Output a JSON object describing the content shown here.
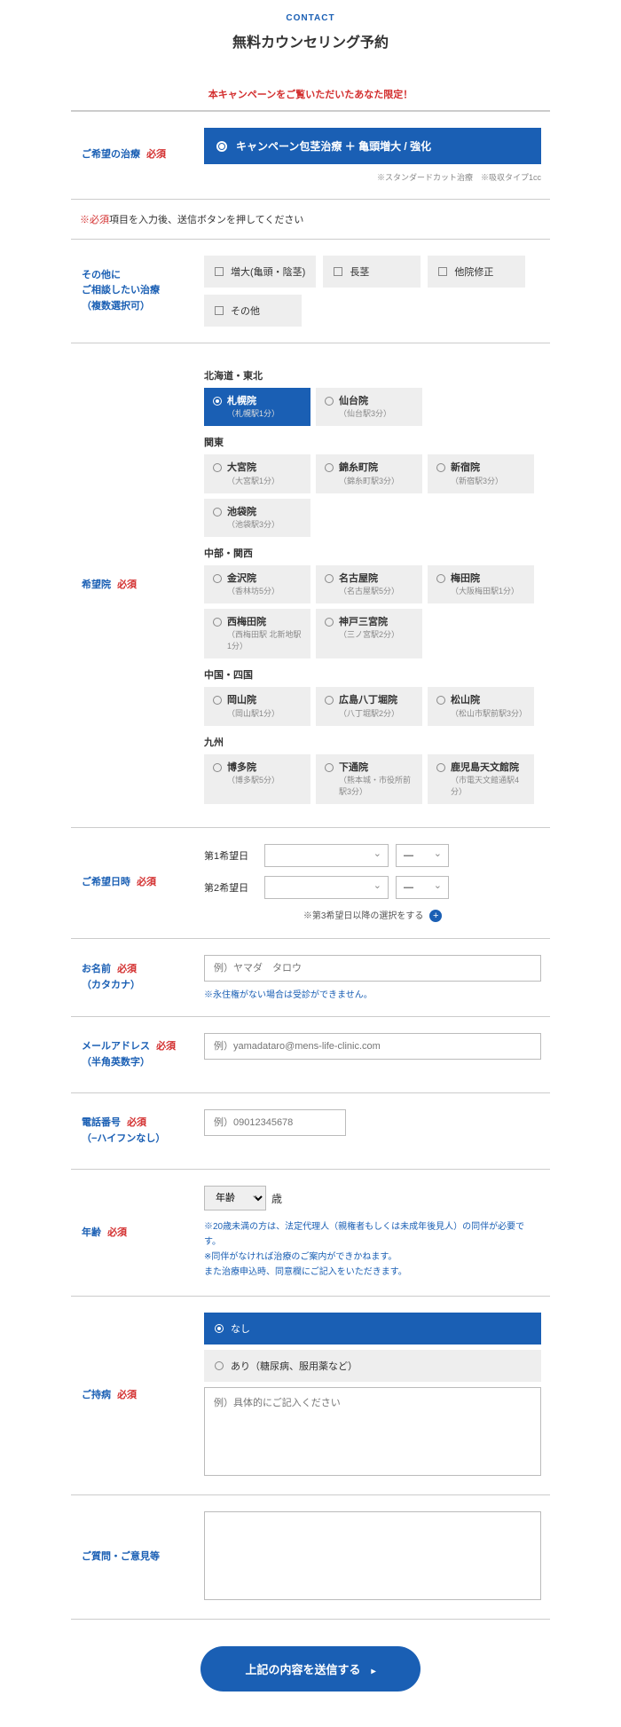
{
  "header": {
    "contact": "CONTACT",
    "title": "無料カウンセリング予約"
  },
  "campaign_note": "本キャンペーンをご覧いただいたあなた限定！",
  "treatment": {
    "label": "ご希望の治療",
    "req": "必須",
    "selected": "キャンペーン包茎治療 ＋ 亀頭増大 / 強化",
    "fine": "※スタンダードカット治療　※吸収タイプ1cc"
  },
  "required_note_star": "※必須",
  "required_note_text": "項目を入力後、送信ボタンを押してください",
  "other": {
    "label1": "その他に",
    "label2": "ご相談したい治療",
    "label3": "（複数選択可）",
    "options": [
      "増大(亀頭・陰茎)",
      "長茎",
      "他院修正",
      "その他"
    ]
  },
  "clinic": {
    "label": "希望院",
    "req": "必須",
    "regions": [
      {
        "name": "北海道・東北",
        "items": [
          {
            "name": "札幌院",
            "sub": "（札幌駅1分）",
            "selected": true
          },
          {
            "name": "仙台院",
            "sub": "（仙台駅3分）"
          }
        ]
      },
      {
        "name": "関東",
        "items": [
          {
            "name": "大宮院",
            "sub": "（大宮駅1分）"
          },
          {
            "name": "錦糸町院",
            "sub": "（錦糸町駅3分）"
          },
          {
            "name": "新宿院",
            "sub": "（新宿駅3分）"
          },
          {
            "name": "池袋院",
            "sub": "（池袋駅3分）"
          }
        ]
      },
      {
        "name": "中部・関西",
        "items": [
          {
            "name": "金沢院",
            "sub": "（香林坊5分）"
          },
          {
            "name": "名古屋院",
            "sub": "（名古屋駅5分）"
          },
          {
            "name": "梅田院",
            "sub": "（大阪梅田駅1分）"
          },
          {
            "name": "西梅田院",
            "sub": "（西梅田駅 北新地駅1分）"
          },
          {
            "name": "神戸三宮院",
            "sub": "（三ノ宮駅2分）"
          }
        ]
      },
      {
        "name": "中国・四国",
        "items": [
          {
            "name": "岡山院",
            "sub": "（岡山駅1分）"
          },
          {
            "name": "広島八丁堀院",
            "sub": "（八丁堀駅2分）"
          },
          {
            "name": "松山院",
            "sub": "（松山市駅前駅3分）"
          }
        ]
      },
      {
        "name": "九州",
        "items": [
          {
            "name": "博多院",
            "sub": "（博多駅5分）"
          },
          {
            "name": "下通院",
            "sub": "（熊本城・市役所前駅3分）"
          },
          {
            "name": "鹿児島天文館院",
            "sub": "（市電天文館通駅4分）"
          }
        ]
      }
    ]
  },
  "datetime": {
    "label": "ご希望日時",
    "req": "必須",
    "row1": "第1希望日",
    "row2": "第2希望日",
    "dash": "—",
    "add_note": "※第3希望日以降の選択をする"
  },
  "name": {
    "label1": "お名前",
    "req": "必須",
    "label2": "（カタカナ）",
    "placeholder": "例）ヤマダ　タロウ",
    "note": "※永住権がない場合は受診ができません。"
  },
  "email": {
    "label1": "メールアドレス",
    "req": "必須",
    "label2": "（半角英数字）",
    "placeholder": "例）yamadataro@mens-life-clinic.com"
  },
  "phone": {
    "label1": "電話番号",
    "req": "必須",
    "label2": "（−ハイフンなし）",
    "placeholder": "例）09012345678"
  },
  "age": {
    "label": "年齢",
    "req": "必須",
    "select_label": "年齢",
    "unit": "歳",
    "note1": "※20歳未満の方は、法定代理人（親権者もしくは未成年後見人）の同伴が必要です。",
    "note2": "※同伴がなければ治療のご案内ができかねます。",
    "note3": "また治療申込時、同意欄にご記入をいただきます。"
  },
  "disease": {
    "label": "ご持病",
    "req": "必須",
    "opt_none": "なし",
    "opt_yes": "あり（糖尿病、服用薬など）",
    "placeholder": "例）具体的にご記入ください"
  },
  "question": {
    "label": "ご質問・ご意見等"
  },
  "submit": "上記の内容を送信する"
}
